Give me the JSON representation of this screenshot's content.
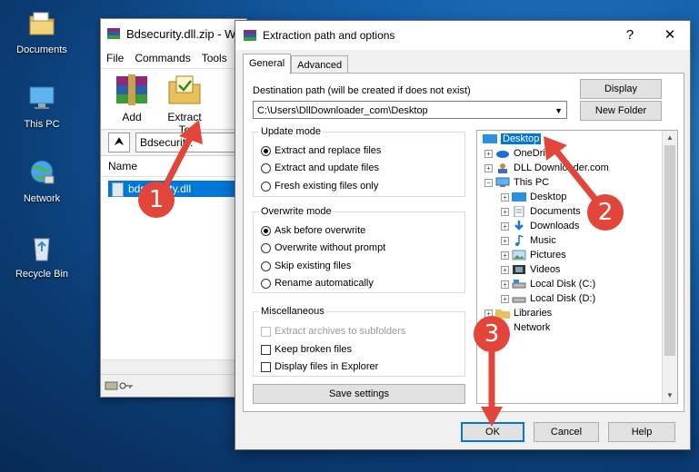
{
  "desktop": {
    "icons": [
      {
        "label": "Documents"
      },
      {
        "label": "This PC"
      },
      {
        "label": "Network"
      },
      {
        "label": "Recycle Bin"
      }
    ]
  },
  "winrar": {
    "title": "Bdsecurity.dll.zip - W",
    "menu": [
      "File",
      "Commands",
      "Tools"
    ],
    "toolbar": {
      "add": "Add",
      "extract_to": "Extract To"
    },
    "path": "Bdsecurity.",
    "column_name": "Name",
    "file": "bdsecurity.dll"
  },
  "dialog": {
    "title": "Extraction path and options",
    "help_symbol": "?",
    "close_symbol": "✕",
    "tabs": [
      "General",
      "Advanced"
    ],
    "destination_label": "Destination path (will be created if does not exist)",
    "destination_value": "C:\\Users\\DllDownloader_com\\Desktop",
    "display_button": "Display",
    "new_folder_button": "New Folder",
    "update_mode": {
      "title": "Update mode",
      "options": [
        "Extract and replace files",
        "Extract and update files",
        "Fresh existing files only"
      ],
      "selected": 0
    },
    "overwrite_mode": {
      "title": "Overwrite mode",
      "options": [
        "Ask before overwrite",
        "Overwrite without prompt",
        "Skip existing files",
        "Rename automatically"
      ],
      "selected": 0
    },
    "misc": {
      "title": "Miscellaneous",
      "options": [
        "Extract archives to subfolders",
        "Keep broken files",
        "Display files in Explorer"
      ]
    },
    "save_settings": "Save settings",
    "tree": {
      "desktop": "Desktop",
      "onedrive": "OneDri",
      "dll": "DLL Downloader.com",
      "thispc": "This PC",
      "pc_desktop": "Desktop",
      "documents": "Documents",
      "downloads": "Downloads",
      "music": "Music",
      "pictures": "Pictures",
      "videos": "Videos",
      "disk_c": "Local Disk (C:)",
      "disk_d": "Local Disk (D:)",
      "libraries": "Libraries",
      "network": "Network"
    },
    "ok": "OK",
    "cancel": "Cancel",
    "help": "Help"
  },
  "callouts": [
    "1",
    "2",
    "3"
  ],
  "colors": {
    "accent": "#0078d7",
    "callout": "#e2453a"
  }
}
